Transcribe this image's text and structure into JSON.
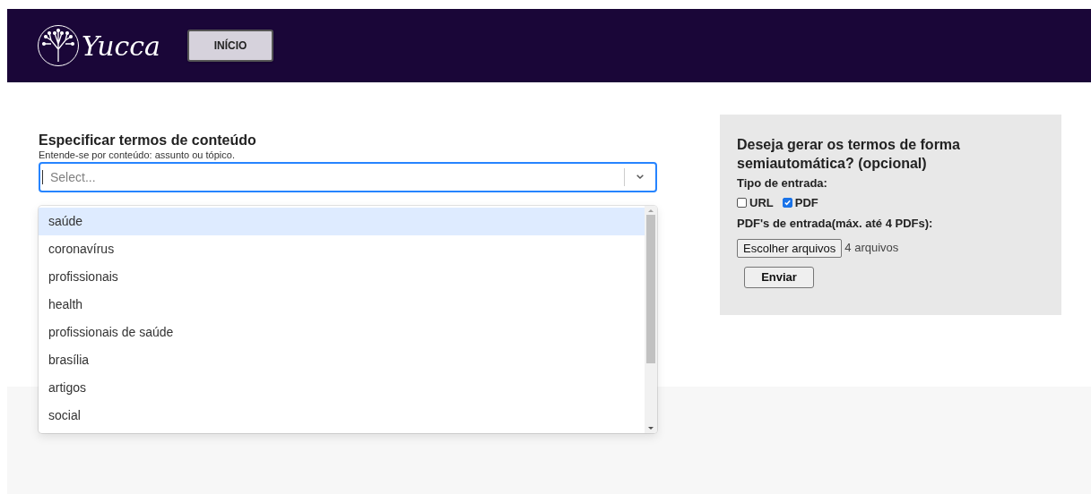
{
  "header": {
    "logo_text": "Yucca",
    "nav": [
      {
        "label": "INÍCIO",
        "selected": false
      }
    ]
  },
  "content_terms": {
    "title": "Especificar termos de conteúdo",
    "hint": "Entende-se por conteúdo: assunto ou tópico.",
    "select": {
      "placeholder": "Select...",
      "expanded": true
    },
    "options": [
      {
        "label": "saúde",
        "selected": true
      },
      {
        "label": "coronavírus",
        "selected": false
      },
      {
        "label": "profissionais",
        "selected": false
      },
      {
        "label": "health",
        "selected": false
      },
      {
        "label": "profissionais de saúde",
        "selected": false
      },
      {
        "label": "brasília",
        "selected": false
      },
      {
        "label": "artigos",
        "selected": false
      },
      {
        "label": "social",
        "selected": false
      }
    ]
  },
  "auto_panel": {
    "title": "Deseja gerar os termos de forma semiautomática? (opcional)",
    "input_type_label": "Tipo de entrada:",
    "input_types": [
      {
        "label": "URL",
        "checked": false
      },
      {
        "label": "PDF",
        "checked": true
      }
    ],
    "files_label": "PDF's de entrada(máx. até 4 PDFs):",
    "file_button": "Escolher arquivos",
    "file_status": "4 arquivos",
    "submit": "Enviar"
  }
}
